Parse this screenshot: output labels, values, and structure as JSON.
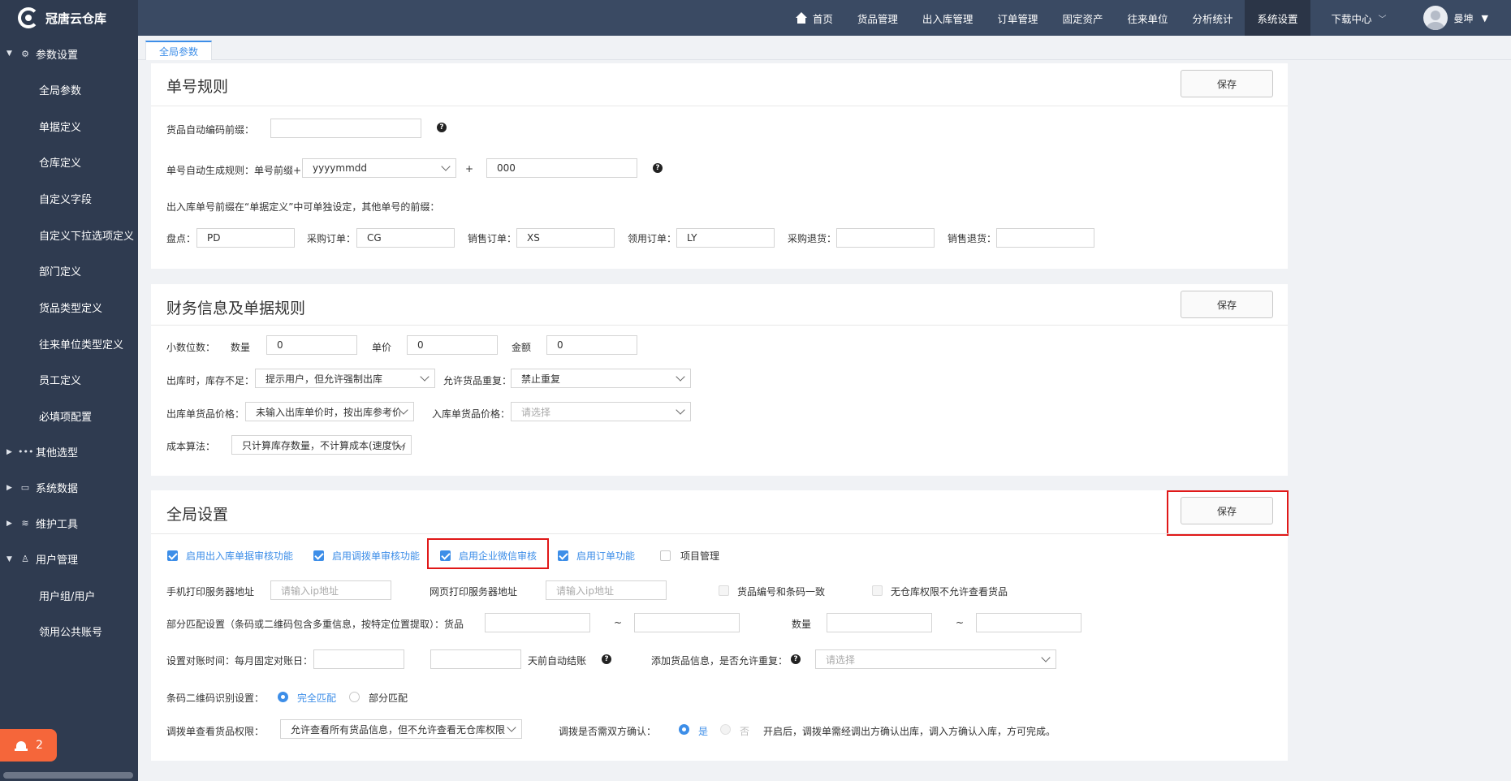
{
  "app": {
    "title": "冠唐云仓库"
  },
  "topnav": {
    "items": [
      "首页",
      "货品管理",
      "出入库管理",
      "订单管理",
      "固定资产",
      "往来单位",
      "分析统计",
      "系统设置"
    ],
    "download": "下载中心",
    "user": "曼坤"
  },
  "sidebar": {
    "groups": {
      "params": "参数设置",
      "other": "其他选型",
      "sysdata": "系统数据",
      "maintain": "维护工具",
      "users": "用户管理"
    },
    "params_items": [
      "全局参数",
      "单据定义",
      "仓库定义",
      "自定义字段",
      "自定义下拉选项定义",
      "部门定义",
      "货品类型定义",
      "往来单位类型定义",
      "员工定义",
      "必填项配置"
    ],
    "user_items": [
      "用户组/用户",
      "领用公共账号"
    ],
    "badge_count": "2"
  },
  "tabs": {
    "active": "全局参数"
  },
  "save_label": "保存",
  "section1": {
    "title": "单号规则",
    "auto_code_label": "货品自动编码前缀：",
    "auto_code_value": "",
    "rule_label": "单号自动生成规则：单号前缀+",
    "date_format": "yyyymmdd",
    "plus": "+",
    "serial": "000",
    "note": "出入库单号前缀在“单据定义”中可单独设定，其他单号的前缀：",
    "prefixes": [
      {
        "label": "盘点：",
        "value": "PD"
      },
      {
        "label": "采购订单：",
        "value": "CG"
      },
      {
        "label": "销售订单：",
        "value": "XS"
      },
      {
        "label": "领用订单：",
        "value": "LY"
      },
      {
        "label": "采购退货：",
        "value": ""
      },
      {
        "label": "销售退货：",
        "value": ""
      }
    ]
  },
  "section2": {
    "title": "财务信息及单据规则",
    "decimals_label": "小数位数：",
    "qty_label": "数量",
    "qty_value": "0",
    "price_label": "单价",
    "price_value": "0",
    "amount_label": "金额",
    "amount_value": "0",
    "stock_short_label": "出库时，库存不足：",
    "stock_short_value": "提示用户，但允许强制出库",
    "dup_label": "允许货品重复：",
    "dup_value": "禁止重复",
    "out_price_label": "出库单货品价格：",
    "out_price_value": "未输入出库单价时，按出库参考价",
    "in_price_label": "入库单货品价格：",
    "in_price_placeholder": "请选择",
    "cost_label": "成本算法：",
    "cost_value": "只计算库存数量，不计算成本(速度快)"
  },
  "section3": {
    "title": "全局设置",
    "checks": [
      {
        "label": "启用出入库单据审核功能",
        "checked": true
      },
      {
        "label": "启用调拨单审核功能",
        "checked": true
      },
      {
        "label": "启用企业微信审核",
        "checked": true
      },
      {
        "label": "启用订单功能",
        "checked": true
      },
      {
        "label": "项目管理",
        "checked": false
      }
    ],
    "mobile_print_label": "手机打印服务器地址",
    "mobile_print_placeholder": "请输入ip地址",
    "web_print_label": "网页打印服务器地址",
    "web_print_placeholder": "请输入ip地址",
    "same_code_label": "货品编号和条码一致",
    "no_wh_label": "无仓库权限不允许查看货品",
    "partial_label": "部分匹配设置（条码或二维码包含多重信息，按特定位置提取）：货品",
    "tilde": "~",
    "qty_label": "数量",
    "recon_label": "设置对账时间：每月固定对账日：",
    "auto_close_label": "天前自动结账",
    "add_goods_label": "添加货品信息，是否允许重复：",
    "add_goods_placeholder": "请选择",
    "barcode_label": "条码二维码识别设置：",
    "full_match": "完全匹配",
    "partial_match": "部分匹配",
    "transfer_view_label": "调拨单查看货品权限：",
    "transfer_view_value": "允许查看所有货品信息，但不允许查看无仓库权限",
    "dual_confirm_label": "调拨是否需双方确认：",
    "yes": "是",
    "no": "否",
    "dual_note": "开启后，调拨单需经调出方确认出库，调入方确认入库，方可完成。"
  }
}
